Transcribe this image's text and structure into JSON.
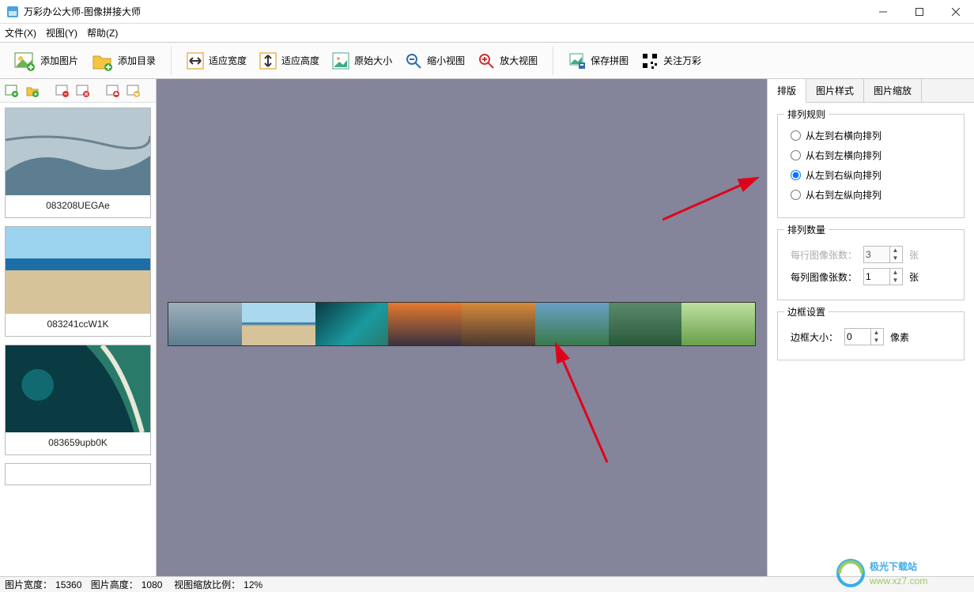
{
  "app": {
    "title": "万彩办公大师-图像拼接大师"
  },
  "menu": {
    "file": "文件(X)",
    "view": "视图(Y)",
    "help": "帮助(Z)"
  },
  "toolbar": {
    "add_image": "添加图片",
    "add_folder": "添加目录",
    "fit_width": "适应宽度",
    "fit_height": "适应高度",
    "orig_size": "原始大小",
    "zoom_out": "缩小视图",
    "zoom_in": "放大视图",
    "save": "保存拼图",
    "about": "关注万彩"
  },
  "thumbs": [
    {
      "name": "083208UEGAe"
    },
    {
      "name": "083241ccW1K"
    },
    {
      "name": "083659upb0K"
    }
  ],
  "tabs": {
    "layout": "排版",
    "style": "图片样式",
    "zoom": "图片缩放"
  },
  "panel": {
    "arrange_rules": {
      "legend": "排列规则",
      "r1": "从左到右横向排列",
      "r2": "从右到左横向排列",
      "r3": "从左到右纵向排列",
      "r4": "从右到左纵向排列",
      "selected": "r3"
    },
    "arrange_count": {
      "legend": "排列数量",
      "per_row_label": "每行图像张数：",
      "per_row_value": "3",
      "per_row_unit": "张",
      "per_col_label": "每列图像张数：",
      "per_col_value": "1",
      "per_col_unit": "张"
    },
    "border": {
      "legend": "边框设置",
      "label": "边框大小：",
      "value": "0",
      "unit": "像素"
    }
  },
  "status": {
    "w_label": "图片宽度：",
    "w_value": "15360",
    "h_label": "图片高度：",
    "h_value": "1080",
    "z_label": "视图缩放比例：",
    "z_value": "12%"
  },
  "watermark": {
    "line1": "极光下载站",
    "line2": "www.xz7.com"
  }
}
